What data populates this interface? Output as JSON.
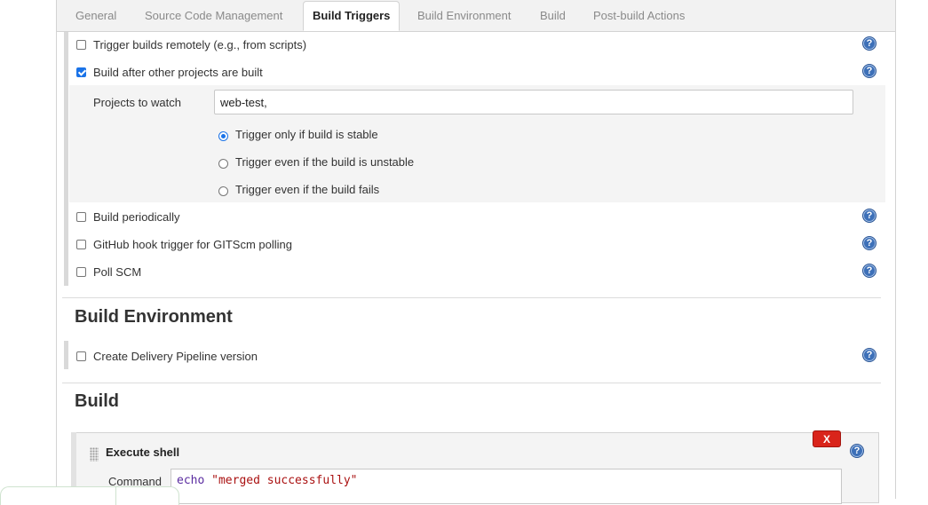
{
  "tabs": [
    {
      "label": "General",
      "active": false
    },
    {
      "label": "Source Code Management",
      "active": false
    },
    {
      "label": "Build Triggers",
      "active": true
    },
    {
      "label": "Build Environment",
      "active": false
    },
    {
      "label": "Build",
      "active": false
    },
    {
      "label": "Post-build Actions",
      "active": false
    }
  ],
  "triggers": {
    "remote": {
      "label": "Trigger builds remotely (e.g., from scripts)",
      "checked": false
    },
    "after_other": {
      "label": "Build after other projects are built",
      "checked": true
    },
    "projects_to_watch": {
      "label": "Projects to watch",
      "value": "web-test,"
    },
    "radio_options": [
      {
        "label": "Trigger only if build is stable",
        "selected": true
      },
      {
        "label": "Trigger even if the build is unstable",
        "selected": false
      },
      {
        "label": "Trigger even if the build fails",
        "selected": false
      }
    ],
    "periodically": {
      "label": "Build periodically",
      "checked": false
    },
    "github_hook": {
      "label": "GitHub hook trigger for GITScm polling",
      "checked": false
    },
    "poll_scm": {
      "label": "Poll SCM",
      "checked": false
    }
  },
  "build_environment": {
    "heading": "Build Environment",
    "delivery_pipeline": {
      "label": "Create Delivery Pipeline version",
      "checked": false
    }
  },
  "build": {
    "heading": "Build",
    "step_title": "Execute shell",
    "delete_label": "X",
    "command_label": "Command",
    "command_keyword": "echo",
    "command_string": "\"merged successfully\""
  },
  "help_glyph": "?",
  "colors": {
    "accent": "#1a73e8",
    "help": "#3d70b8",
    "delete": "#d9241b",
    "shade": "#f4f4f4"
  }
}
